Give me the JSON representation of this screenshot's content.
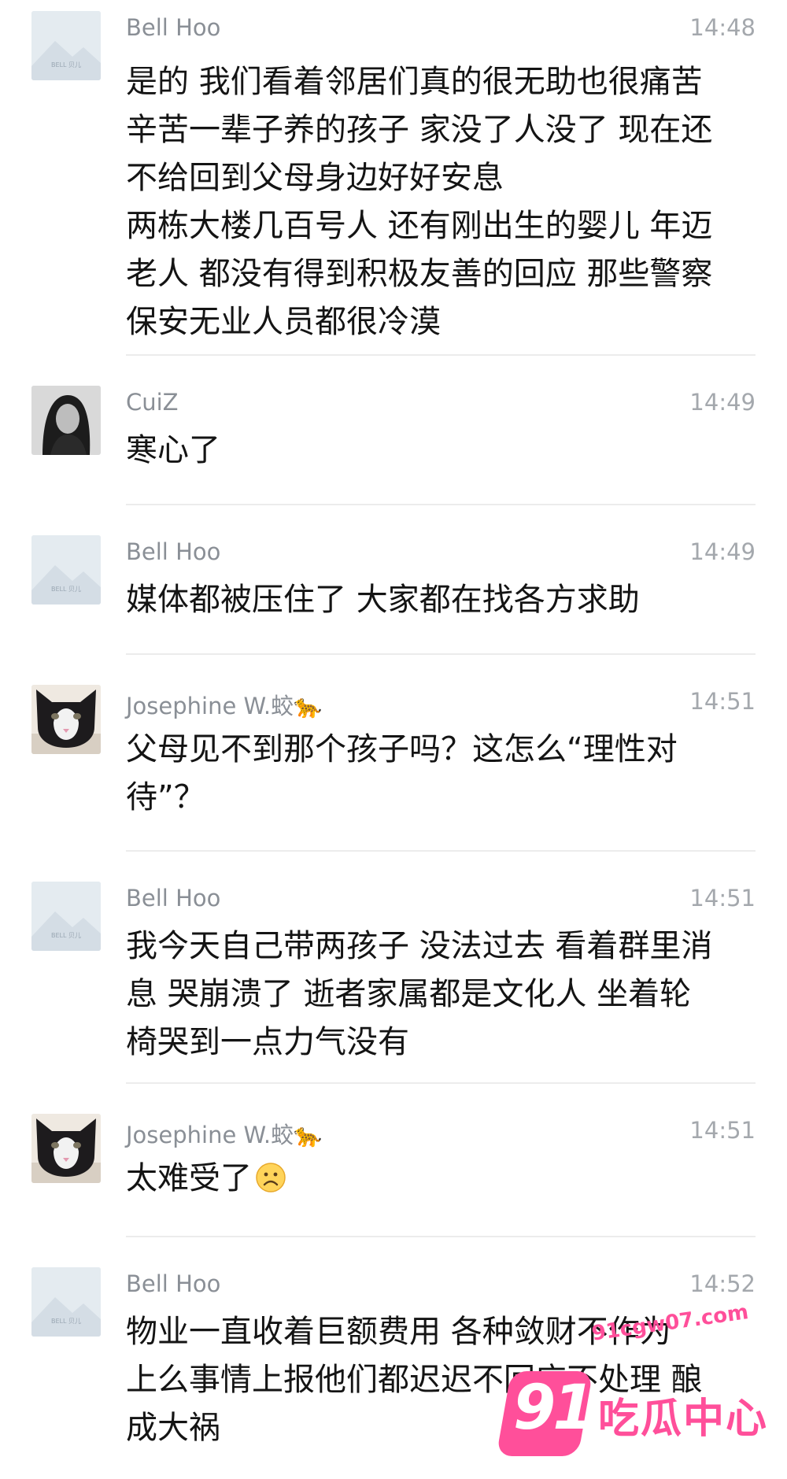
{
  "messages": [
    {
      "name": "Bell Hoo",
      "time": "14:48",
      "avatar": "landscape-placeholder-icon",
      "avatar_caption": "BELL 贝儿",
      "lines": [
        "是的 我们看着邻居们真的很无助也很痛苦",
        "辛苦一辈子养的孩子 家没了人没了 现在还",
        "不给回到父母身边好好安息",
        "两栋大楼几百号人 还有刚出生的婴儿 年迈",
        "老人 都没有得到积极友善的回应 那些警察",
        "保安无业人员都很冷漠"
      ]
    },
    {
      "name": "CuiZ",
      "time": "14:49",
      "avatar": "portrait-photo",
      "lines": [
        "寒心了"
      ]
    },
    {
      "name": "Bell Hoo",
      "time": "14:49",
      "avatar": "landscape-placeholder-icon",
      "avatar_caption": "BELL 贝儿",
      "lines": [
        "媒体都被压住了 大家都在找各方求助"
      ]
    },
    {
      "name": "Josephine W.蛟🐆",
      "time": "14:51",
      "avatar": "cat-photo",
      "lines": [
        "父母见不到那个孩子吗？这怎么“理性对",
        "待”？"
      ]
    },
    {
      "name": "Bell Hoo",
      "time": "14:51",
      "avatar": "landscape-placeholder-icon",
      "avatar_caption": "BELL 贝儿",
      "lines": [
        "我今天自己带两孩子 没法过去 看着群里消",
        "息 哭崩溃了 逝者家属都是文化人 坐着轮",
        "椅哭到一点力气没有"
      ]
    },
    {
      "name": "Josephine W.蛟🐆",
      "time": "14:51",
      "avatar": "cat-photo",
      "lines": [
        "太难受了"
      ],
      "emoji": "sad-face-icon"
    },
    {
      "name": "Bell Hoo",
      "time": "14:52",
      "avatar": "landscape-placeholder-icon",
      "avatar_caption": "BELL 贝儿",
      "lines": [
        "物业一直收着巨额费用 各种敛财不作为",
        "上么事情上报他们都迟迟不回应不处理 酿",
        "成大祸"
      ]
    }
  ],
  "watermark": {
    "logo_number": "91",
    "logo_text": "吃瓜中心",
    "url": "91cgw07.com",
    "color": "#ff4f9a"
  }
}
